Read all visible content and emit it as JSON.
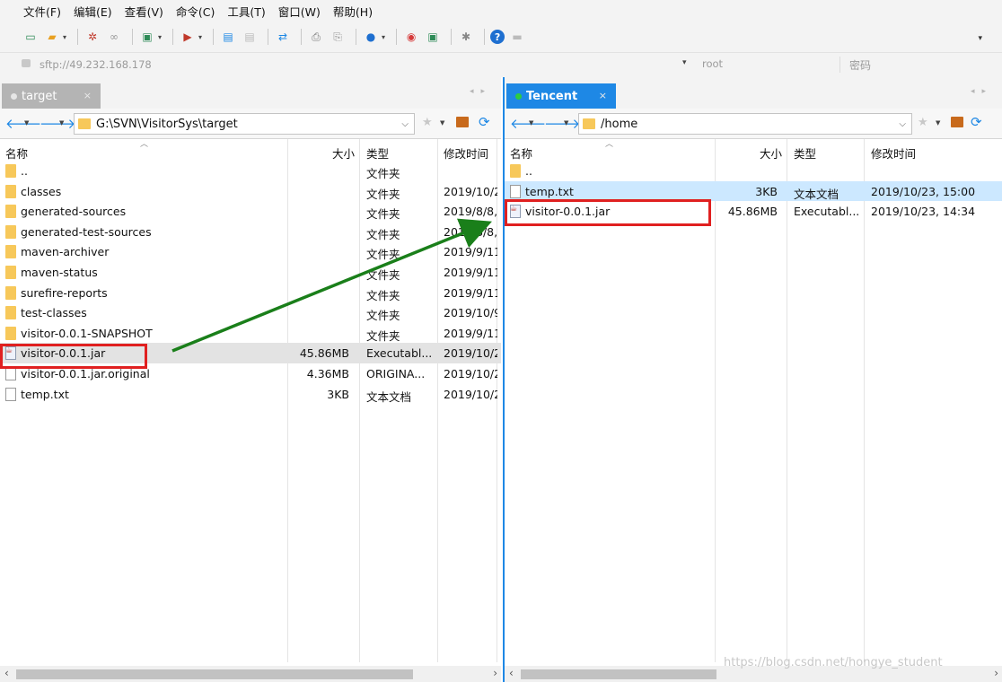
{
  "menu": [
    "文件(F)",
    "编辑(E)",
    "查看(V)",
    "命令(C)",
    "工具(T)",
    "窗口(W)",
    "帮助(H)"
  ],
  "address": {
    "url": "sftp://49.232.168.178",
    "user": "root",
    "password_label": "密码"
  },
  "left": {
    "tab": "target",
    "tab_close": "×",
    "path": "G:\\SVN\\VisitorSys\\target",
    "columns": {
      "name": "名称",
      "size": "大小",
      "type": "类型",
      "modified": "修改时间"
    },
    "files": [
      {
        "name": "..",
        "size": "",
        "type": "文件夹",
        "modified": "",
        "icon": "folder"
      },
      {
        "name": "classes",
        "size": "",
        "type": "文件夹",
        "modified": "2019/10/2",
        "icon": "folder"
      },
      {
        "name": "generated-sources",
        "size": "",
        "type": "文件夹",
        "modified": "2019/8/8,",
        "icon": "folder"
      },
      {
        "name": "generated-test-sources",
        "size": "",
        "type": "文件夹",
        "modified": "2019/8/8,",
        "icon": "folder"
      },
      {
        "name": "maven-archiver",
        "size": "",
        "type": "文件夹",
        "modified": "2019/9/11",
        "icon": "folder"
      },
      {
        "name": "maven-status",
        "size": "",
        "type": "文件夹",
        "modified": "2019/9/11",
        "icon": "folder"
      },
      {
        "name": "surefire-reports",
        "size": "",
        "type": "文件夹",
        "modified": "2019/9/11",
        "icon": "folder"
      },
      {
        "name": "test-classes",
        "size": "",
        "type": "文件夹",
        "modified": "2019/10/9",
        "icon": "folder"
      },
      {
        "name": "visitor-0.0.1-SNAPSHOT",
        "size": "",
        "type": "文件夹",
        "modified": "2019/9/11",
        "icon": "folder"
      },
      {
        "name": "visitor-0.0.1.jar",
        "size": "45.86MB",
        "type": "Executabl...",
        "modified": "2019/10/2",
        "icon": "jar"
      },
      {
        "name": "visitor-0.0.1.jar.original",
        "size": "4.36MB",
        "type": "ORIGINA...",
        "modified": "2019/10/2",
        "icon": "doc"
      },
      {
        "name": "temp.txt",
        "size": "3KB",
        "type": "文本文档",
        "modified": "2019/10/2",
        "icon": "doc"
      }
    ]
  },
  "right": {
    "tab": "Tencent",
    "tab_close": "×",
    "path": "/home",
    "columns": {
      "name": "名称",
      "size": "大小",
      "type": "类型",
      "modified": "修改时间"
    },
    "files": [
      {
        "name": "..",
        "size": "",
        "type": "",
        "modified": "",
        "icon": "folder"
      },
      {
        "name": "temp.txt",
        "size": "3KB",
        "type": "文本文档",
        "modified": "2019/10/23, 15:00",
        "icon": "doc"
      },
      {
        "name": "visitor-0.0.1.jar",
        "size": "45.86MB",
        "type": "Executabl...",
        "modified": "2019/10/23, 14:34",
        "icon": "jar"
      }
    ]
  },
  "watermark": "https://blog.csdn.net/hongye_student",
  "colors": {
    "accent": "#1e88e5",
    "highlight_box": "#e02020",
    "arrow": "#1a7f1a"
  }
}
